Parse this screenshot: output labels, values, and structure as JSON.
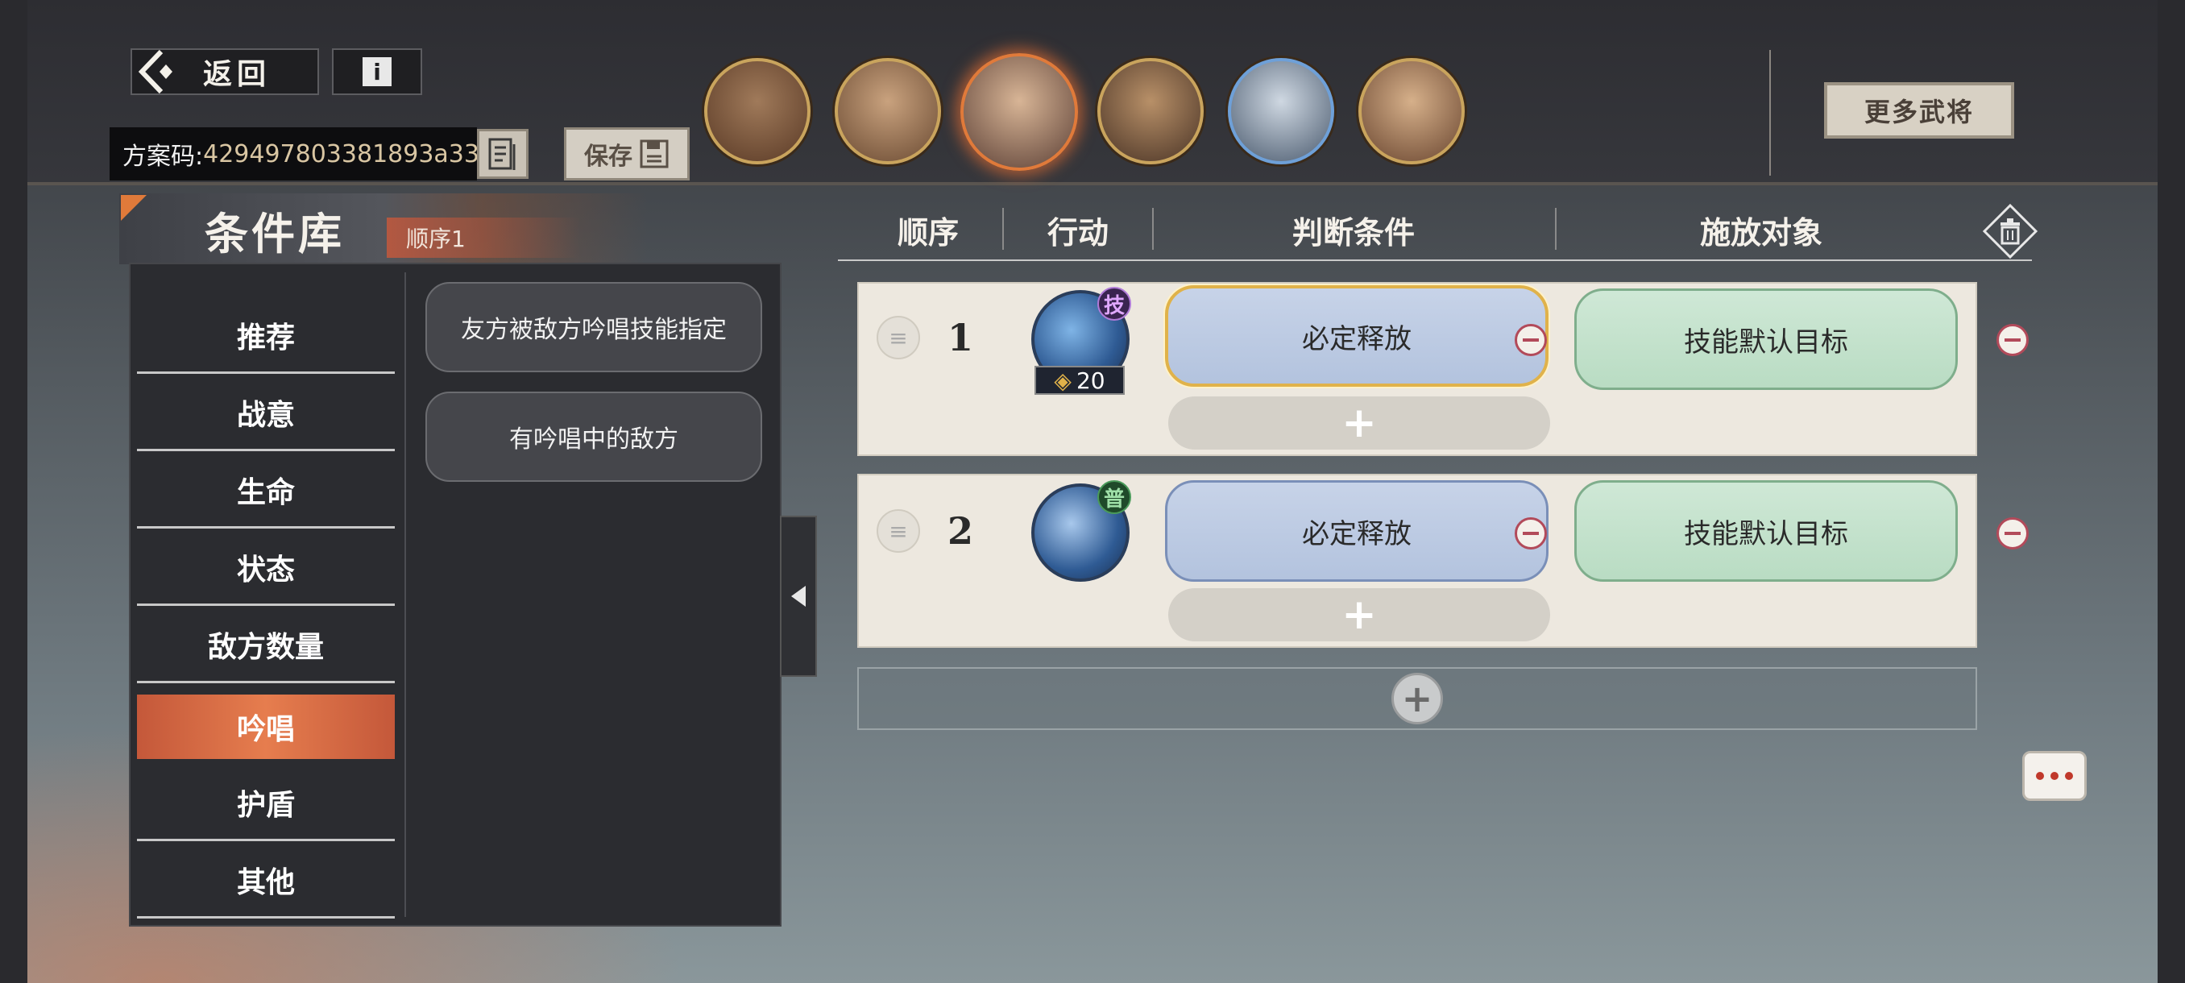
{
  "header": {
    "back_label": "返回",
    "info_label": "i",
    "plan_code_label": "方案码:",
    "plan_code_value": "429497803381893a33",
    "save_label": "保存",
    "more_generals_label": "更多武将"
  },
  "generals": [
    {
      "name": "general-1",
      "selected": false
    },
    {
      "name": "general-2",
      "selected": false
    },
    {
      "name": "general-3",
      "selected": true
    },
    {
      "name": "general-4",
      "selected": false
    },
    {
      "name": "general-5",
      "selected": false
    },
    {
      "name": "general-6",
      "selected": false
    }
  ],
  "library": {
    "title": "条件库",
    "tag": "顺序1",
    "categories": [
      "推荐",
      "战意",
      "生命",
      "状态",
      "敌方数量",
      "吟唱",
      "护盾",
      "其他"
    ],
    "active_category": "吟唱",
    "options": [
      "友方被敌方吟唱技能指定",
      "有吟唱中的敌方"
    ]
  },
  "table": {
    "headers": [
      "顺序",
      "行动",
      "判断条件",
      "施放对象"
    ],
    "rows": [
      {
        "order": "1",
        "skill_badge": "技",
        "skill_cost": "20",
        "condition": "必定释放",
        "target": "技能默认目标"
      },
      {
        "order": "2",
        "skill_badge": "普",
        "skill_cost": "",
        "condition": "必定释放",
        "target": "技能默认目标"
      }
    ]
  },
  "colors": {
    "accent_orange": "#e07a3a",
    "condition_blue": "#c7d3e8",
    "target_green": "#cfe8d6",
    "remove_red": "#b24a5a"
  }
}
